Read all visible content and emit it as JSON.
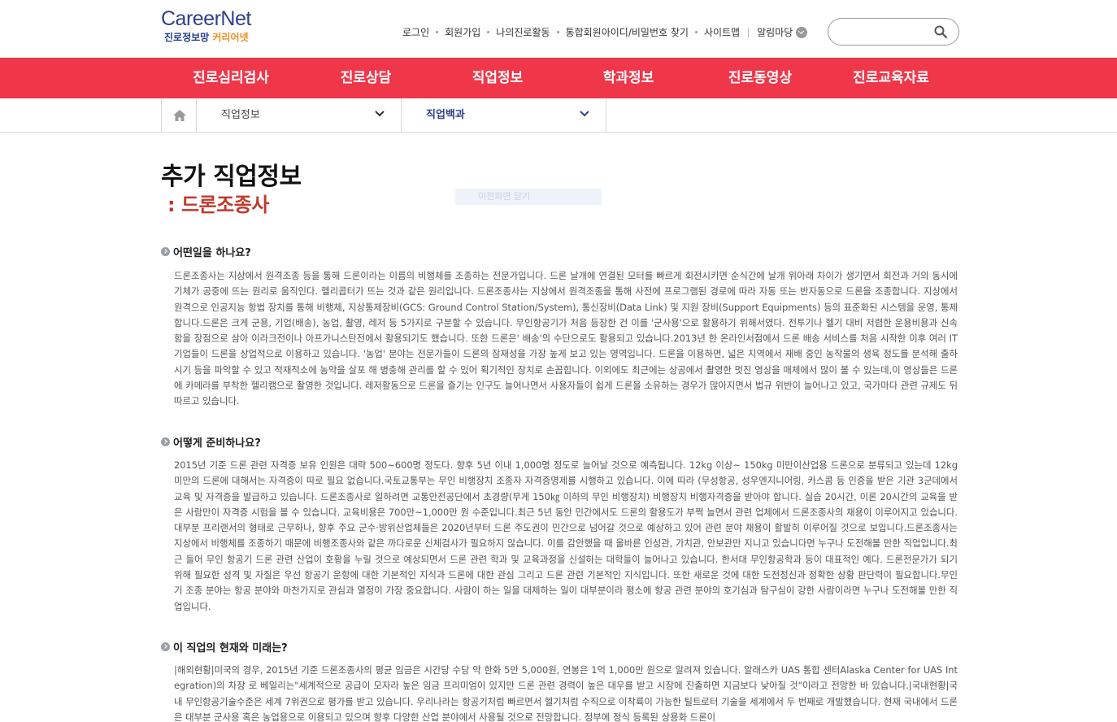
{
  "logo": {
    "main_prefix": "Career",
    "main_n": "N",
    "main_suffix": "et",
    "sub_a": "진로정보망 ",
    "sub_b": "커리어넷"
  },
  "topnav": {
    "login": "로그인",
    "signup": "회원가입",
    "my_activity": "나의진로활동",
    "find_account": "통합회원아이디/비밀번호 찾기",
    "sitemap": "사이트맵",
    "alarm": "알림마당"
  },
  "search": {
    "placeholder": "",
    "value": ""
  },
  "mainnav": [
    "진로심리검사",
    "진로상담",
    "직업정보",
    "학과정보",
    "진로동영상",
    "진로교육자료"
  ],
  "breadcrumb": {
    "level1": "직업정보",
    "level2": "직업백과"
  },
  "page": {
    "title": "추가 직업정보",
    "subtitle": ": 드론조종사",
    "faded_label": "이전화면 닫기"
  },
  "sections": [
    {
      "heading": "어떤일을 하나요?",
      "body": "드론조종사는 지상에서 원격조종 등을 통해 드론이라는 이름의 비행체를 조종하는 전문가입니다. 드론 날개에 연결된 모터를 빠르게 회전시키면 순식간에 날개 위아래 차이가 생기면서 회전과 거의 동시에 기체가 공중에 뜨는 원리로 움직인다. 헬리콥터가 뜨는 것과 같은 원리입니다. 드론조종사는 지상에서 원격조종을 통해 사전에 프로그램된 경로에 따라 자동 또는 반자동으로 드론을 조종합니다. 지상에서 원격으로 인공지능 항법 장치를 통해 비행체, 지상통제장비(GCS: Ground Control Station/System), 통신장비(Data Link) 및 지원 장비(Support Equipments) 등의 표준화된 시스템을 운영, 통제합니다.드론은 크게 군용, 기업(배송), 농업, 촬영, 레저 등 5가지로 구분할 수 있습니다. 무인항공기가 처음 등장한 건 이를 '군사용'으로 활용하기 위해서였다. 전투기나 헬기 대비 저렴한 운용비용과 신속함을 장점으로 삼아 이라크전이나 아프가니스탄전에서 활용되기도 했습니다. 또한 드론은' 배송'의 수단으로도 활용되고 있습니다.2013년 한 온라인서점에서 드론 배송 서비스를 처음 시작한 이후 여러 IT 기업들이 드론을 상업적으로 이용하고 있습니다. '농업' 분야는 전문가들이 드론의 잠재성을 가장 높게 보고 있는 영역입니다. 드론을 이용하면, 넓은 지역에서 재배 중인 농작물의 생육 정도를 분석해 출하시기 등을 파악할 수 있고 적재적소에 농약을 살포 해 병충해 관리를 할 수 있어 획기적인 장치로 손꼽힙니다. 이외에도 최근에는 상공에서 촬영한 멋진 영상을 매체에서 많이 볼 수 있는데,이 영상들은 드론에 카메라를 부착한 헬리캠으로 촬영한 것입니다. 레저활동으로 드론을 즐기는 인구도 늘어나면서 사용자들이 쉽게 드론을 소유하는 경우가 많아지면서 법규 위반이 늘어나고 있고, 국가마다 관련 규제도 뒤따르고 있습니다."
    },
    {
      "heading": "어떻게 준비하나요?",
      "body": "2015년 기준 드론 관련 자격증 보유 인원은 대략 500~600명 정도다. 향후 5년 이내 1,000명 정도로 늘어날 것으로 예측됩니다. 12kg 이상~ 150kg 미만이산업용 드론으로 분류되고 있는데 12kg 미만의 드론에 대해서는 자격증이 따로 필요 없습니다.국토교통부는 무인 비행장치 조종자 자격증명제를 시행하고 있습니다. 이에 따라 (무성항공, 성우엔지니어링, 카스콤 등 인증을 받은 기관 3군데에서 교육 및 자격증을 발급하고 있습니다. 드론조종사로 일하려면 교통안전공단에서 초경량(무게 150㎏ 이하의 무인 비행장치) 비행장치 비행자격증을 받아야 합니다. 실습 20시간, 이론 20시간의 교육을 받은 사람만이 자격증 시험을 볼 수 있습니다. 교육비용은 700만~1,000만 원 수준입니다.최근 5년 동안 민간에서도 드론의 활용도가 부쩍 늘면서 관련 업체에서 드론조종사의 채용이 이루어지고 있습니다. 대부분 프리랜서의 형태로 근무하나, 향후 주요 군수·방위산업체들은 2020년부터 드론 주도권이 민간으로 넘어갈 것으로 예상하고 있어 관련 분야 채용이 활발히 이루어질 것으로 보입니다.드론조종사는 지상에서 비행체를 조종하기 때문에 비행조종사와 같은 까다로운 신체검사가 필요하지 않습니다. 이를 감안했을 때 올바른 인성관, 가치관, 안보관만 지니고 있습니다면 누구나 도전해볼 만한 직업입니다.최근 들어 무인 항공기 드론 관련 산업이 호황을 누릴 것으로 예상되면서 드론 관련 학과 및 교육과정을 신설하는 대학들이 늘어나고 있습니다. 한서대 무인항공학과 등이 대표적인 예다. 드론전문가가 되기 위해 필요한 성격 및 자질은 우선 항공기 운항에 대한 기본적인 지식과 드론에 대한 관심 그리고 드론 관련 기본적인 지식입니다. 또한 새로운 것에 대한 도전정신과 정확한 상황 판단력이 필요합니다.무인기 조종 분야는 항공 분야와 마찬가지로 관심과 열정이 가장 중요합니다. 사람이 하는 일을 대체하는 일이 대부분이라 평소에 항공 관련 분야의 호기심과 탐구심이 강한 사람이라면 누구나 도전해볼 만한 직업입니다."
    },
    {
      "heading": "이 직업의 현재와 미래는?",
      "body": "|해외현황|미국의 경우, 2015년 기준 드론조종사의 평균 임금은 시간당 수당 약 한화 5만 5,000원, 연봉은 1억 1,000만 원으로 알려져 있습니다. 알래스카 UAS 통합 센터Alaska Center for UAS Integration)의 차장 로 베일리는\"세계적으로 공급이 모자라 높은 임금 프리미엄이 있지만 드론 관련 경력이 높은 대우를 받고 시장에 진출하면 지금보다 낮아질 것\"이라고 전망한 바 있습니다.|국내현황|국내 무인항공기술수준은 세계 7위권으로 평가를 받고 있습니다. 우리나라는 항공기처럼 빠르면서 헬기처럼 수직으로 이착륙이 가능한 틸트로터 기술을 세계에서 두 번째로 개발했습니다. 현재 국내에서 드론은 대부분 군사용 혹은 농업용으로 이용되고 있으며 향후 다양한 산업 분야에서 사용될 것으로 전망합니다. 정부에 정식 등록된 상용화 드론이"
    }
  ]
}
